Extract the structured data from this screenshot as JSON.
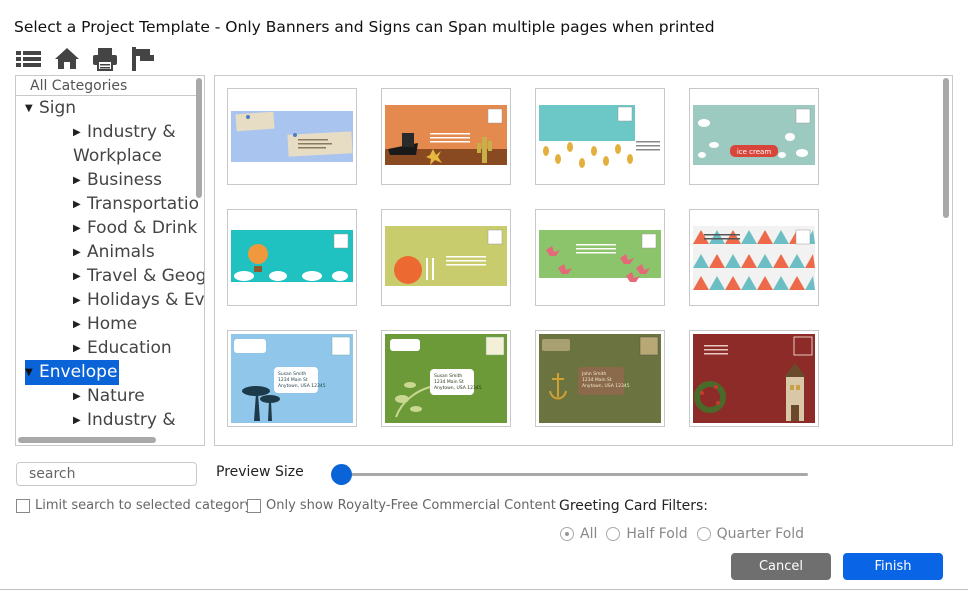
{
  "dialog": {
    "title": "Select a Project Template - Only Banners and Signs can Span multiple pages when printed"
  },
  "toolbar": {
    "icons": [
      "list-icon",
      "home-icon",
      "printer-icon",
      "flag-icon"
    ]
  },
  "tree": {
    "header": "All Categories",
    "items": [
      {
        "label": "Sign",
        "level": 0,
        "arrow": "▼"
      },
      {
        "label": "Industry &",
        "level": 1,
        "arrow": "▶"
      },
      {
        "label": "Workplace",
        "level": 1,
        "arrow": ""
      },
      {
        "label": "Business",
        "level": 1,
        "arrow": "▶"
      },
      {
        "label": "Transportatio",
        "level": 1,
        "arrow": "▶"
      },
      {
        "label": "Food & Drink",
        "level": 1,
        "arrow": "▶"
      },
      {
        "label": "Animals",
        "level": 1,
        "arrow": "▶"
      },
      {
        "label": "Travel & Geog",
        "level": 1,
        "arrow": "▶"
      },
      {
        "label": "Holidays & Eve",
        "level": 1,
        "arrow": "▶"
      },
      {
        "label": "Home",
        "level": 1,
        "arrow": "▶"
      },
      {
        "label": "Education",
        "level": 1,
        "arrow": "▶"
      },
      {
        "label": "Envelope",
        "level": 0,
        "arrow": "▼",
        "selected": true
      },
      {
        "label": "Nature",
        "level": 1,
        "arrow": "▶"
      },
      {
        "label": "Industry &",
        "level": 1,
        "arrow": "▶"
      }
    ]
  },
  "templates": {
    "address_lines": [
      "Susan Smith",
      "1234 Main St",
      "Anytown, USA 12345"
    ],
    "address_lines_alt": [
      "John Smith",
      "1234 Main St",
      "Anytown, USA 12345"
    ],
    "ice_cream_text": "ice cream",
    "colors": {
      "blue": "#a8c4ef",
      "orange": "#e58a4e",
      "teal": "#6bc8c6",
      "mint": "#9cc9c0",
      "turquoise": "#1fc1c1",
      "olive": "#c9cc6c",
      "green": "#8bc46a",
      "geo": "#f2f2f2",
      "sky": "#8fc6ea",
      "leaf": "#6d9a39",
      "grunge": "#6b7340",
      "maroon": "#8c2b27"
    }
  },
  "search": {
    "placeholder": "search",
    "value": ""
  },
  "preview": {
    "label": "Preview Size",
    "value_percent": 0
  },
  "checkboxes": {
    "limit_search": "Limit search to selected category",
    "royalty_free": "Only show Royalty-Free Commercial Content"
  },
  "greeting": {
    "label": "Greeting Card Filters:",
    "options": [
      "All",
      "Half Fold",
      "Quarter Fold"
    ],
    "selected": "All"
  },
  "buttons": {
    "cancel": "Cancel",
    "finish": "Finish"
  },
  "accent_color": "#0a64d8"
}
